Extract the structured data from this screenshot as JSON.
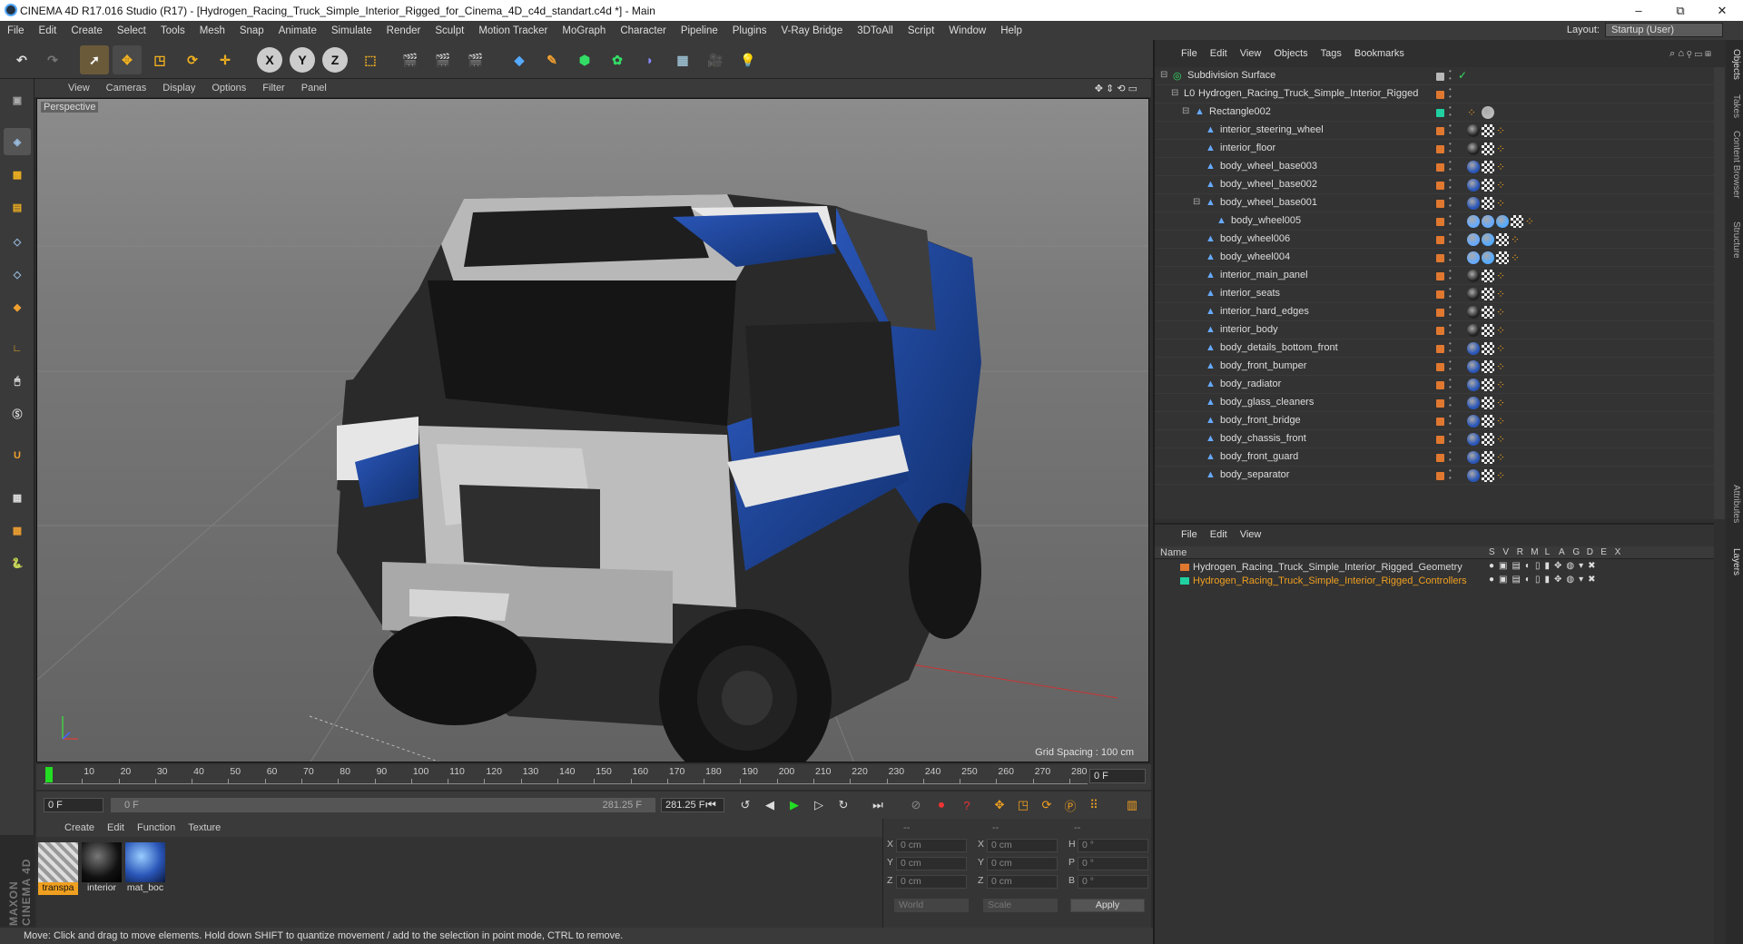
{
  "title": "CINEMA 4D R17.016 Studio (R17) - [Hydrogen_Racing_Truck_Simple_Interior_Rigged_for_Cinema_4D_c4d_standart.c4d *] - Main",
  "window_controls": {
    "min": "–",
    "max": "⧉",
    "close": "✕"
  },
  "menu": [
    "File",
    "Edit",
    "Create",
    "Select",
    "Tools",
    "Mesh",
    "Snap",
    "Animate",
    "Simulate",
    "Render",
    "Sculpt",
    "Motion Tracker",
    "MoGraph",
    "Character",
    "Pipeline",
    "Plugins",
    "V-Ray Bridge",
    "3DToAll",
    "Script",
    "Window",
    "Help"
  ],
  "layout": {
    "label": "Layout:",
    "value": "Startup (User)"
  },
  "toolbar": {
    "x": "X",
    "y": "Y",
    "z": "Z"
  },
  "viewport": {
    "menu": [
      "View",
      "Cameras",
      "Display",
      "Options",
      "Filter",
      "Panel"
    ],
    "label": "Perspective",
    "grid_spacing": "Grid Spacing : 100 cm"
  },
  "timeline": {
    "ticks": [
      "0",
      "10",
      "20",
      "30",
      "40",
      "50",
      "60",
      "70",
      "80",
      "90",
      "100",
      "110",
      "120",
      "130",
      "140",
      "150",
      "160",
      "170",
      "180",
      "190",
      "200",
      "210",
      "220",
      "230",
      "240",
      "250",
      "260",
      "270",
      "280"
    ],
    "frame": "0 F"
  },
  "transport": {
    "start": "0 F",
    "slider_left": "0 F",
    "slider_right": "281.25 F",
    "end": "281.25 F"
  },
  "materials": {
    "menu": [
      "Create",
      "Edit",
      "Function",
      "Texture"
    ],
    "items": [
      {
        "name": "transpa",
        "selected": true
      },
      {
        "name": "interior",
        "selected": false
      },
      {
        "name": "mat_boc",
        "selected": false
      }
    ]
  },
  "coords": {
    "header": [
      "--",
      "--",
      "--"
    ],
    "rows": [
      {
        "a": "X",
        "av": "0 cm",
        "b": "X",
        "bv": "0 cm",
        "c": "H",
        "cv": "0 °"
      },
      {
        "a": "Y",
        "av": "0 cm",
        "b": "Y",
        "bv": "0 cm",
        "c": "P",
        "cv": "0 °"
      },
      {
        "a": "Z",
        "av": "0 cm",
        "b": "Z",
        "bv": "0 cm",
        "c": "B",
        "cv": "0 °"
      }
    ],
    "world": "World",
    "scale": "Scale",
    "apply": "Apply"
  },
  "status": "Move: Click and drag to move elements. Hold down SHIFT to quantize movement / add to the selection in point mode, CTRL to remove.",
  "brand": "MAXON CINEMA 4D",
  "object_manager": {
    "menu": [
      "File",
      "Edit",
      "View",
      "Objects",
      "Tags",
      "Bookmarks"
    ],
    "objects": [
      {
        "name": "Subdivision Surface",
        "level": 0,
        "color": "#b8b8b8"
      },
      {
        "name": "Hydrogen_Racing_Truck_Simple_Interior_Rigged",
        "level": 1,
        "color": "#e07830"
      },
      {
        "name": "Rectangle002",
        "level": 2,
        "color": "#20d0a0"
      },
      {
        "name": "interior_steering_wheel",
        "level": 3,
        "color": "#e07830"
      },
      {
        "name": "interior_floor",
        "level": 3,
        "color": "#e07830"
      },
      {
        "name": "body_wheel_base003",
        "level": 3,
        "color": "#e07830"
      },
      {
        "name": "body_wheel_base002",
        "level": 3,
        "color": "#e07830"
      },
      {
        "name": "body_wheel_base001",
        "level": 3,
        "color": "#e07830"
      },
      {
        "name": "body_wheel005",
        "level": 4,
        "color": "#e07830"
      },
      {
        "name": "body_wheel006",
        "level": 3,
        "color": "#e07830"
      },
      {
        "name": "body_wheel004",
        "level": 3,
        "color": "#e07830"
      },
      {
        "name": "interior_main_panel",
        "level": 3,
        "color": "#e07830"
      },
      {
        "name": "interior_seats",
        "level": 3,
        "color": "#e07830"
      },
      {
        "name": "interior_hard_edges",
        "level": 3,
        "color": "#e07830"
      },
      {
        "name": "interior_body",
        "level": 3,
        "color": "#e07830"
      },
      {
        "name": "body_details_bottom_front",
        "level": 3,
        "color": "#e07830"
      },
      {
        "name": "body_front_bumper",
        "level": 3,
        "color": "#e07830"
      },
      {
        "name": "body_radiator",
        "level": 3,
        "color": "#e07830"
      },
      {
        "name": "body_glass_cleaners",
        "level": 3,
        "color": "#e07830"
      },
      {
        "name": "body_front_bridge",
        "level": 3,
        "color": "#e07830"
      },
      {
        "name": "body_chassis_front",
        "level": 3,
        "color": "#e07830"
      },
      {
        "name": "body_front_guard",
        "level": 3,
        "color": "#e07830"
      },
      {
        "name": "body_separator",
        "level": 3,
        "color": "#e07830"
      }
    ]
  },
  "layer_manager": {
    "menu": [
      "File",
      "Edit",
      "View"
    ],
    "header": {
      "name": "Name",
      "cols": [
        "S",
        "V",
        "R",
        "M",
        "L",
        "A",
        "G",
        "D",
        "E",
        "X"
      ]
    },
    "layers": [
      {
        "name": "Hydrogen_Racing_Truck_Simple_Interior_Rigged_Geometry",
        "color": "#e07830",
        "textcolor": "#d8d8d8"
      },
      {
        "name": "Hydrogen_Racing_Truck_Simple_Interior_Rigged_Controllers",
        "color": "#20d0a0",
        "textcolor": "#f0a020"
      }
    ]
  },
  "side_tabs": [
    "Objects",
    "Takes",
    "Content Browser",
    "Structure",
    "Attributes",
    "Layers"
  ]
}
